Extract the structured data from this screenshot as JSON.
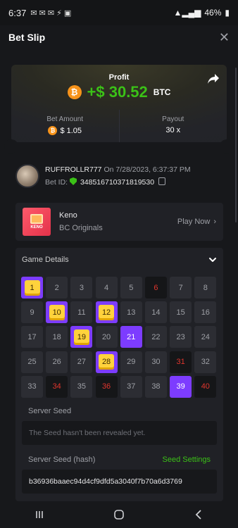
{
  "status_bar": {
    "time": "6:37",
    "battery": "46%"
  },
  "header": {
    "title": "Bet Slip"
  },
  "profit": {
    "label": "Profit",
    "value": "+$ 30.52",
    "currency": "BTC",
    "coin_symbol": "₿",
    "bet_amount_label": "Bet Amount",
    "bet_amount": "$ 1.05",
    "payout_label": "Payout",
    "payout": "30 x"
  },
  "user": {
    "name": "RUFFROLLR777",
    "date_text": "On 7/28/2023, 6:37:37 PM",
    "bet_id_label": "Bet ID:",
    "bet_id": "348516710371819530"
  },
  "game": {
    "logo_text": "KENO",
    "name": "Keno",
    "provider": "BC Originals",
    "play_label": "Play Now"
  },
  "details": {
    "title": "Game Details",
    "cells": [
      {
        "n": "1",
        "s": "hit"
      },
      {
        "n": "2",
        "s": "none"
      },
      {
        "n": "3",
        "s": "none"
      },
      {
        "n": "4",
        "s": "none"
      },
      {
        "n": "5",
        "s": "none"
      },
      {
        "n": "6",
        "s": "miss"
      },
      {
        "n": "7",
        "s": "none"
      },
      {
        "n": "8",
        "s": "none"
      },
      {
        "n": "9",
        "s": "none"
      },
      {
        "n": "10",
        "s": "hit"
      },
      {
        "n": "11",
        "s": "none"
      },
      {
        "n": "12",
        "s": "hit"
      },
      {
        "n": "13",
        "s": "none"
      },
      {
        "n": "14",
        "s": "none"
      },
      {
        "n": "15",
        "s": "none"
      },
      {
        "n": "16",
        "s": "none"
      },
      {
        "n": "17",
        "s": "none"
      },
      {
        "n": "18",
        "s": "none"
      },
      {
        "n": "19",
        "s": "hit"
      },
      {
        "n": "20",
        "s": "none"
      },
      {
        "n": "21",
        "s": "pick"
      },
      {
        "n": "22",
        "s": "none"
      },
      {
        "n": "23",
        "s": "none"
      },
      {
        "n": "24",
        "s": "none"
      },
      {
        "n": "25",
        "s": "none"
      },
      {
        "n": "26",
        "s": "none"
      },
      {
        "n": "27",
        "s": "none"
      },
      {
        "n": "28",
        "s": "hit"
      },
      {
        "n": "29",
        "s": "none"
      },
      {
        "n": "30",
        "s": "none"
      },
      {
        "n": "31",
        "s": "miss"
      },
      {
        "n": "32",
        "s": "none"
      },
      {
        "n": "33",
        "s": "none"
      },
      {
        "n": "34",
        "s": "miss"
      },
      {
        "n": "35",
        "s": "none"
      },
      {
        "n": "36",
        "s": "miss"
      },
      {
        "n": "37",
        "s": "none"
      },
      {
        "n": "38",
        "s": "none"
      },
      {
        "n": "39",
        "s": "pick"
      },
      {
        "n": "40",
        "s": "miss"
      }
    ],
    "server_seed_label": "Server Seed",
    "server_seed_placeholder": "The Seed hasn't been revealed yet.",
    "server_seed_hash_label": "Server Seed (hash)",
    "seed_settings_label": "Seed Settings",
    "server_seed_hash": "b36936baaec94d4cf9dfd5a3040f7b70a6d3769"
  },
  "colors": {
    "accent_green": "#3bc117",
    "pick_purple": "#7d3cff",
    "hit_gold": "#ffd23c",
    "miss_red": "#e0352d"
  }
}
